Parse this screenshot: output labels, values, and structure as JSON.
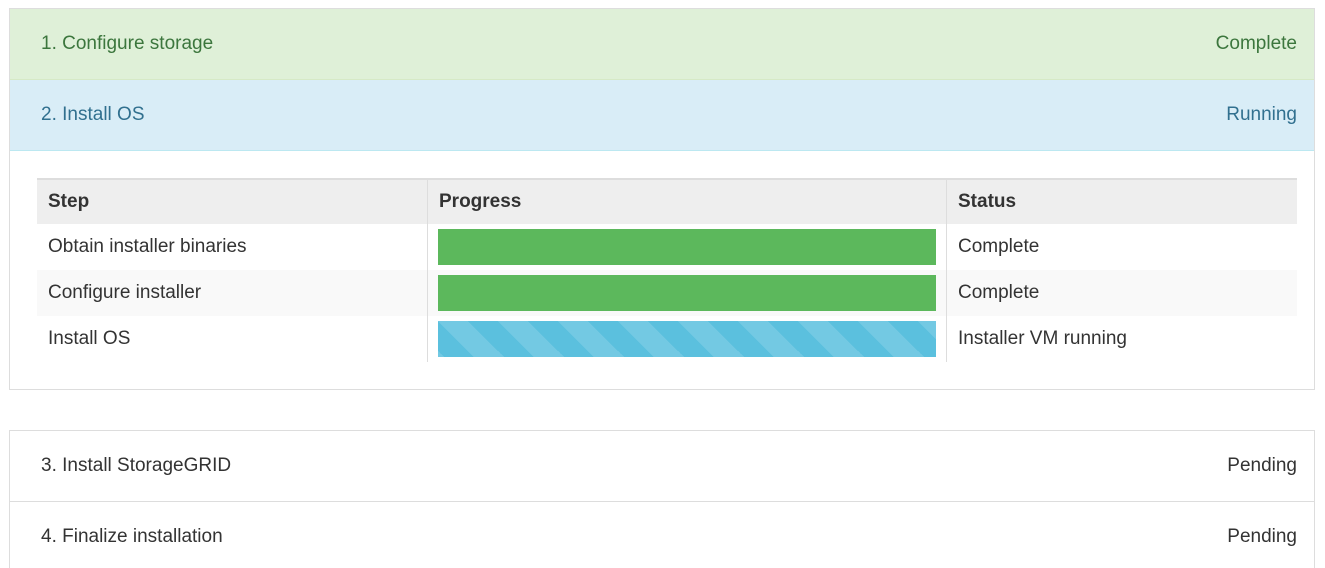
{
  "stages": [
    {
      "label": "1. Configure storage",
      "status": "Complete"
    },
    {
      "label": "2. Install OS",
      "status": "Running"
    },
    {
      "label": "3. Install StorageGRID",
      "status": "Pending"
    },
    {
      "label": "4. Finalize installation",
      "status": "Pending"
    }
  ],
  "steps_table": {
    "headers": {
      "step": "Step",
      "progress": "Progress",
      "status": "Status"
    },
    "rows": [
      {
        "step": "Obtain installer binaries",
        "progress": 1.0,
        "progress_style": "success",
        "status": "Complete"
      },
      {
        "step": "Configure installer",
        "progress": 1.0,
        "progress_style": "success",
        "status": "Complete"
      },
      {
        "step": "Install OS",
        "progress": 1.0,
        "progress_style": "info-striped",
        "status": "Installer VM running"
      }
    ]
  },
  "colors": {
    "complete_bg": "#dff0d8",
    "complete_text": "#3c763d",
    "running_bg": "#d9edf7",
    "running_text": "#31708f",
    "progress_success": "#5cb85c",
    "progress_info": "#5bc0de"
  }
}
